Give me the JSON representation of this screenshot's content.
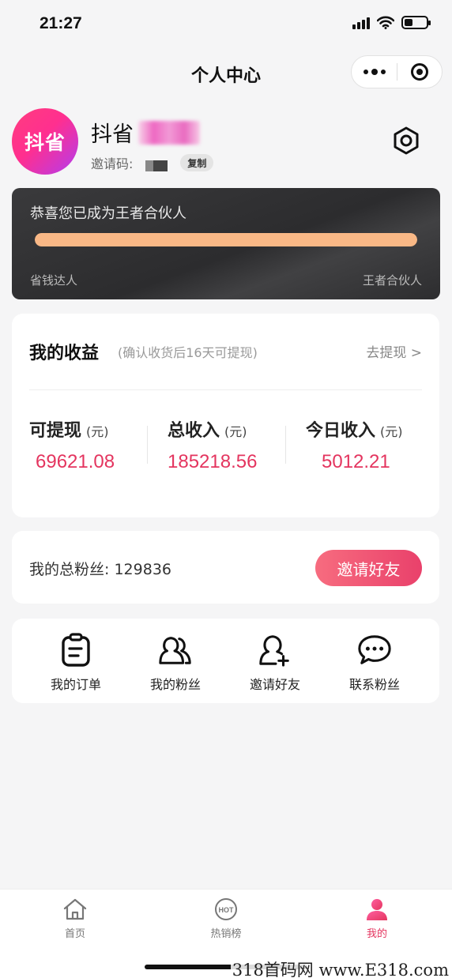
{
  "status_bar": {
    "time": "21:27"
  },
  "nav": {
    "title": "个人中心"
  },
  "profile": {
    "avatar_text": "抖省",
    "username": "抖省",
    "invite_label": "邀请码:",
    "copy_label": "复制"
  },
  "vip": {
    "title": "恭喜您已成为王者合伙人",
    "progress_percent": 100,
    "level_start": "省钱达人",
    "level_end": "王者合伙人"
  },
  "earnings": {
    "title": "我的收益",
    "note": "(确认收货后16天可提现)",
    "withdraw_link": "去提现 >",
    "unit": "(元)",
    "items": [
      {
        "label": "可提现",
        "value": "69621.08"
      },
      {
        "label": "总收入",
        "value": "185218.56"
      },
      {
        "label": "今日收入",
        "value": "5012.21"
      }
    ]
  },
  "fans": {
    "label": "我的总粉丝",
    "separator": ": ",
    "count": "129836",
    "invite_button": "邀请好友"
  },
  "menu": [
    {
      "label": "我的订单",
      "icon": "order-icon"
    },
    {
      "label": "我的粉丝",
      "icon": "fans-icon"
    },
    {
      "label": "邀请好友",
      "icon": "add-user-icon"
    },
    {
      "label": "联系粉丝",
      "icon": "chat-icon"
    }
  ],
  "tabs": [
    {
      "label": "首页",
      "icon": "home-icon"
    },
    {
      "label": "热销榜",
      "icon": "hot-icon",
      "badge": "HOT"
    },
    {
      "label": "我的",
      "icon": "user-icon"
    }
  ],
  "watermark": "318首码网 www.E318.com",
  "colors": {
    "accent": "#e4355f",
    "progress": "#f9b886",
    "vip_card": "#2c2c2e"
  }
}
